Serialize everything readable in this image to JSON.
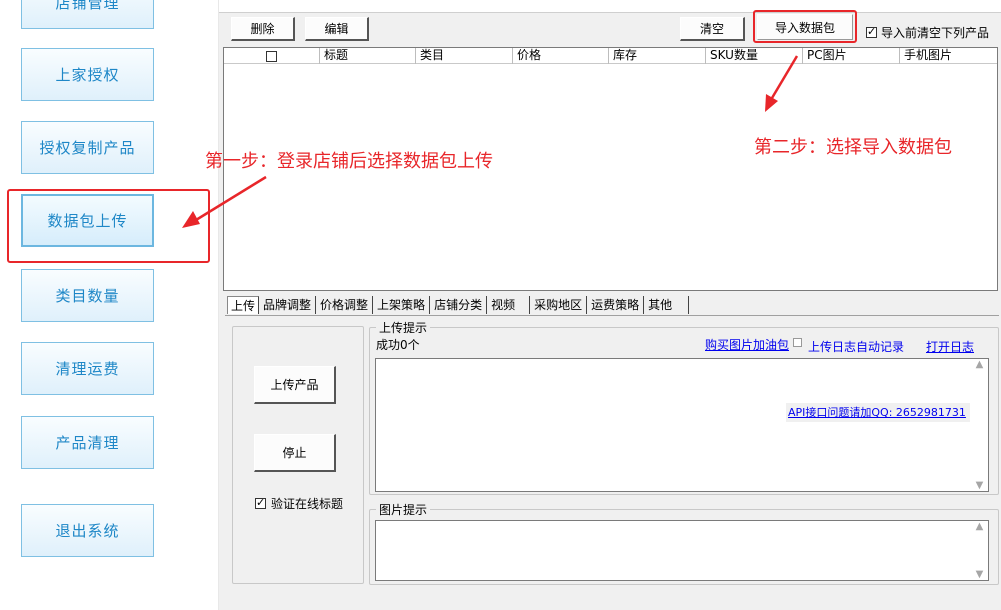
{
  "sidebar": {
    "items": [
      {
        "label": "店铺管理"
      },
      {
        "label": "上家授权"
      },
      {
        "label": "授权复制产品"
      },
      {
        "label": "数据包上传"
      },
      {
        "label": "类目数量"
      },
      {
        "label": "清理运费"
      },
      {
        "label": "产品清理"
      },
      {
        "label": "退出系统"
      }
    ],
    "active_index": 3
  },
  "toolbar": {
    "delete_label": "删除",
    "edit_label": "编辑",
    "clear_label": "清空",
    "import_label": "导入数据包",
    "clear_before_import_label": "导入前清空下列产品",
    "clear_before_import_checked": true
  },
  "grid": {
    "columns": [
      "",
      "标题",
      "类目",
      "价格",
      "库存",
      "SKU数量",
      "PC图片",
      "手机图片"
    ],
    "rows": []
  },
  "tabs": [
    "上传",
    "品牌调整",
    "价格调整",
    "上架策略",
    "店铺分类",
    "视频",
    "采购地区",
    "运费策略",
    "其他"
  ],
  "active_tab": "上传",
  "upload_panel": {
    "upload_button": "上传产品",
    "stop_button": "停止",
    "verify_title_label": "验证在线标题",
    "verify_title_checked": true
  },
  "upload_tip": {
    "title": "上传提示",
    "status": "成功0个",
    "buy_image_link": "购买图片加油包",
    "auto_log_label": "上传日志自动记录",
    "open_log_link": "打开日志",
    "api_notice": "API接口问题请加QQ: 2652981731"
  },
  "image_tip": {
    "title": "图片提示"
  },
  "annotations": {
    "step1": "第一步：登录店铺后选择数据包上传",
    "step2": "第二步：选择导入数据包"
  },
  "colors": {
    "annotation_red": "#e8262a",
    "sidebar_text": "#1e87c7",
    "sidebar_border": "#7fc0e3",
    "link_blue": "#0000ee"
  }
}
